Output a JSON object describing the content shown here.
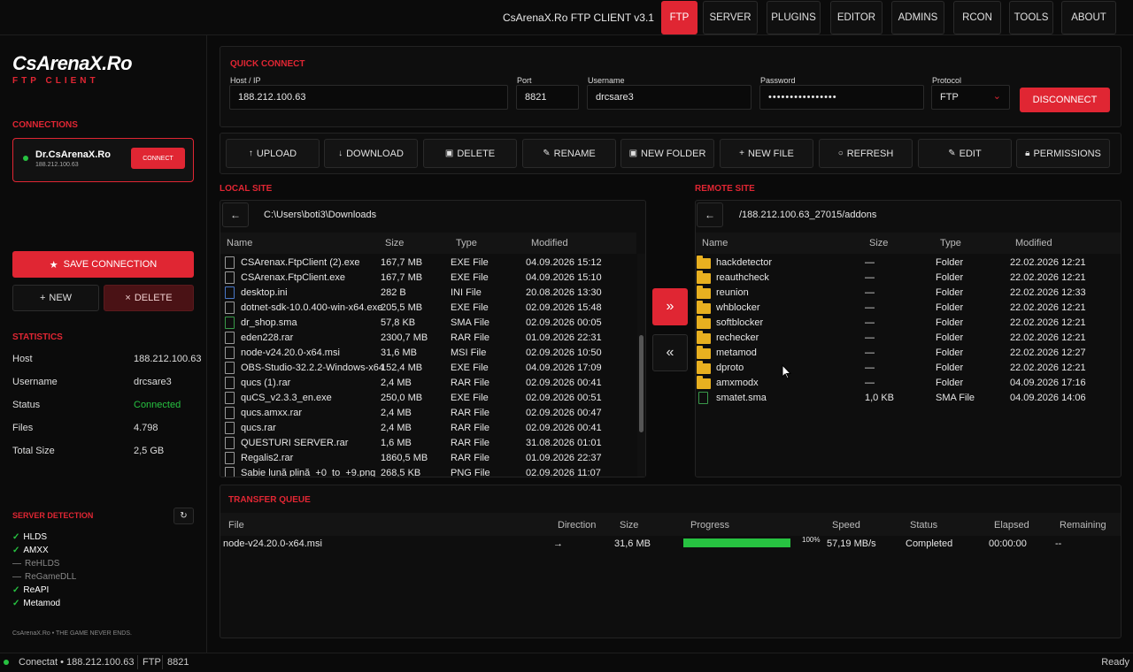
{
  "app": {
    "title": "CsArenaX.Ro FTP CLIENT v3.1"
  },
  "nav": {
    "tabs": [
      "FTP",
      "SERVER",
      "PLUGINS",
      "EDITOR",
      "ADMINS",
      "RCON",
      "TOOLS",
      "ABOUT"
    ],
    "active": "FTP"
  },
  "logo": {
    "name": "CsArenaX.Ro",
    "sub": "FTP CLIENT"
  },
  "sidebar": {
    "connections_label": "CONNECTIONS",
    "connection": {
      "name": "Dr.CsArenaX.Ro",
      "host": "188.212.100.63",
      "button": "CONNECT"
    },
    "save_label": "SAVE CONNECTION",
    "new_label": "NEW",
    "delete_label": "DELETE",
    "statistics_label": "STATISTICS",
    "stats": [
      {
        "key": "Host",
        "value": "188.212.100.63"
      },
      {
        "key": "Username",
        "value": "drcsare3"
      },
      {
        "key": "Status",
        "value": "Connected"
      },
      {
        "key": "Files",
        "value": "4.798"
      },
      {
        "key": "Total Size",
        "value": "2,5 GB"
      }
    ],
    "detection_label": "SERVER DETECTION",
    "detection": [
      {
        "name": "HLDS",
        "on": true
      },
      {
        "name": "AMXX",
        "on": true
      },
      {
        "name": "ReHLDS",
        "on": false
      },
      {
        "name": "ReGameDLL",
        "on": false
      },
      {
        "name": "ReAPI",
        "on": true
      },
      {
        "name": "Metamod",
        "on": true
      }
    ],
    "footer": "CsArenaX.Ro • THE GAME NEVER ENDS."
  },
  "quick_connect": {
    "label": "QUICK CONNECT",
    "host_label": "Host / IP",
    "host": "188.212.100.63",
    "port_label": "Port",
    "port": "8821",
    "user_label": "Username",
    "user": "drcsare3",
    "pass_label": "Password",
    "pass": "••••••••••••••••",
    "proto_label": "Protocol",
    "proto": "FTP",
    "disconnect": "DISCONNECT"
  },
  "toolbar": {
    "upload": "UPLOAD",
    "download": "DOWNLOAD",
    "delete": "DELETE",
    "rename": "RENAME",
    "new_folder": "NEW FOLDER",
    "new_file": "NEW FILE",
    "refresh": "REFRESH",
    "edit": "EDIT",
    "permissions": "PERMISSIONS"
  },
  "local": {
    "label": "LOCAL SITE",
    "path": "C:\\Users\\boti3\\Downloads",
    "headers": [
      "Name",
      "Size",
      "Type",
      "Modified"
    ],
    "files": [
      {
        "name": "CSArenax.FtpClient (2).exe",
        "size": "167,7 MB",
        "type": "EXE File",
        "mod": "04.09.2026 15:12",
        "icon": "file"
      },
      {
        "name": "CSArenax.FtpClient.exe",
        "size": "167,7 MB",
        "type": "EXE File",
        "mod": "04.09.2026 15:10",
        "icon": "file"
      },
      {
        "name": "desktop.ini",
        "size": "282 B",
        "type": "INI File",
        "mod": "20.08.2026 13:30",
        "icon": "blue"
      },
      {
        "name": "dotnet-sdk-10.0.400-win-x64.exe",
        "size": "205,5 MB",
        "type": "EXE File",
        "mod": "02.09.2026 15:48",
        "icon": "file"
      },
      {
        "name": "dr_shop.sma",
        "size": "57,8 KB",
        "type": "SMA File",
        "mod": "02.09.2026 00:05",
        "icon": "green"
      },
      {
        "name": "eden228.rar",
        "size": "2300,7 MB",
        "type": "RAR File",
        "mod": "01.09.2026 22:31",
        "icon": "file"
      },
      {
        "name": "node-v24.20.0-x64.msi",
        "size": "31,6 MB",
        "type": "MSI File",
        "mod": "02.09.2026 10:50",
        "icon": "file"
      },
      {
        "name": "OBS-Studio-32.2.2-Windows-x64",
        "size": "152,4 MB",
        "type": "EXE File",
        "mod": "04.09.2026 17:09",
        "icon": "file"
      },
      {
        "name": "qucs (1).rar",
        "size": "2,4 MB",
        "type": "RAR File",
        "mod": "02.09.2026 00:41",
        "icon": "file"
      },
      {
        "name": "quCS_v2.3.3_en.exe",
        "size": "250,0 MB",
        "type": "EXE File",
        "mod": "02.09.2026 00:51",
        "icon": "file"
      },
      {
        "name": "qucs.amxx.rar",
        "size": "2,4 MB",
        "type": "RAR File",
        "mod": "02.09.2026 00:47",
        "icon": "file"
      },
      {
        "name": "qucs.rar",
        "size": "2,4 MB",
        "type": "RAR File",
        "mod": "02.09.2026 00:41",
        "icon": "file"
      },
      {
        "name": "QUESTURI SERVER.rar",
        "size": "1,6 MB",
        "type": "RAR File",
        "mod": "31.08.2026 01:01",
        "icon": "file"
      },
      {
        "name": "Regalis2.rar",
        "size": "1860,5 MB",
        "type": "RAR File",
        "mod": "01.09.2026 22:37",
        "icon": "file"
      },
      {
        "name": "Sabie lună plină_+0_to_+9.png",
        "size": "268,5 KB",
        "type": "PNG File",
        "mod": "02.09.2026 11:07",
        "icon": "file"
      }
    ]
  },
  "transfer": {
    "upload_arrow": "»",
    "download_arrow": "«"
  },
  "remote": {
    "label": "REMOTE SITE",
    "path": "/188.212.100.63_27015/addons",
    "headers": [
      "Name",
      "Size",
      "Type",
      "Modified"
    ],
    "files": [
      {
        "name": "hackdetector",
        "size": "—",
        "type": "Folder",
        "mod": "22.02.2026 12:21",
        "icon": "folder"
      },
      {
        "name": "reauthcheck",
        "size": "—",
        "type": "Folder",
        "mod": "22.02.2026 12:21",
        "icon": "folder"
      },
      {
        "name": "reunion",
        "size": "—",
        "type": "Folder",
        "mod": "22.02.2026 12:33",
        "icon": "folder"
      },
      {
        "name": "whblocker",
        "size": "—",
        "type": "Folder",
        "mod": "22.02.2026 12:21",
        "icon": "folder"
      },
      {
        "name": "softblocker",
        "size": "—",
        "type": "Folder",
        "mod": "22.02.2026 12:21",
        "icon": "folder"
      },
      {
        "name": "rechecker",
        "size": "—",
        "type": "Folder",
        "mod": "22.02.2026 12:21",
        "icon": "folder"
      },
      {
        "name": "metamod",
        "size": "—",
        "type": "Folder",
        "mod": "22.02.2026 12:27",
        "icon": "folder"
      },
      {
        "name": "dproto",
        "size": "—",
        "type": "Folder",
        "mod": "22.02.2026 12:21",
        "icon": "folder"
      },
      {
        "name": "amxmodx",
        "size": "—",
        "type": "Folder",
        "mod": "04.09.2026 17:16",
        "icon": "folder"
      },
      {
        "name": "smatet.sma",
        "size": "1,0 KB",
        "type": "SMA File",
        "mod": "04.09.2026 14:06",
        "icon": "green"
      }
    ]
  },
  "queue": {
    "label": "TRANSFER QUEUE",
    "headers": [
      "File",
      "Direction",
      "Size",
      "Progress",
      "Speed",
      "Status",
      "Elapsed",
      "Remaining"
    ],
    "items": [
      {
        "file": "node-v24.20.0-x64.msi",
        "direction": "→",
        "size": "31,6 MB",
        "progress": 100,
        "progress_label": "100%",
        "speed": "57,19 MB/s",
        "status": "Completed",
        "elapsed": "00:00:00",
        "remaining": "--"
      }
    ]
  },
  "statusbar": {
    "text": "Conectat • 188.212.100.63",
    "proto": "FTP",
    "port": "8821",
    "right": "Ready"
  },
  "colors": {
    "accent": "#e02633",
    "ok": "#27c241",
    "folder": "#e8b020"
  }
}
